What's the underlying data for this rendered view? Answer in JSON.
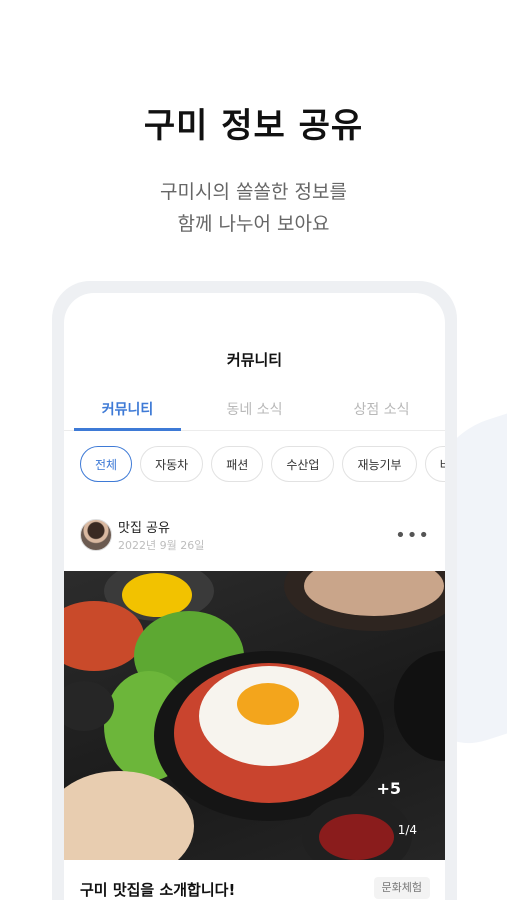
{
  "hero": {
    "title": "구미 정보 공유",
    "subtitle_line1": "구미시의 쏠쏠한 정보를",
    "subtitle_line2": "함께 나누어 보아요"
  },
  "app": {
    "title": "커뮤니티",
    "tabs": [
      {
        "label": "커뮤니티",
        "active": true
      },
      {
        "label": "동네 소식",
        "active": false
      },
      {
        "label": "상점 소식",
        "active": false
      }
    ],
    "chips": [
      {
        "label": "전체",
        "active": true
      },
      {
        "label": "자동차",
        "active": false
      },
      {
        "label": "패션",
        "active": false
      },
      {
        "label": "수산업",
        "active": false
      },
      {
        "label": "재능기부",
        "active": false
      },
      {
        "label": "비지니",
        "active": false
      }
    ]
  },
  "post": {
    "category": "맛집 공유",
    "date": "2022년 9월 26일",
    "image_count": "+5",
    "image_page": "1/4",
    "title": "구미 맛집을 소개합니다!",
    "tag": "문화체험"
  },
  "colors": {
    "accent": "#3e7ad6",
    "muted": "#b8b8b8"
  }
}
